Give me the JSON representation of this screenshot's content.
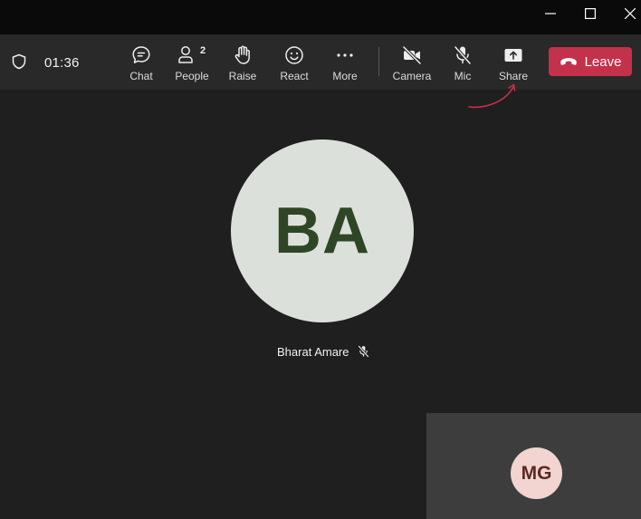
{
  "window": {
    "minimize_icon": "minimize-icon",
    "maximize_icon": "maximize-icon",
    "close_icon": "close-icon"
  },
  "toolbar": {
    "timer": "01:36",
    "shield_icon": "shield-icon",
    "buttons": [
      {
        "label": "Chat",
        "icon": "chat-icon"
      },
      {
        "label": "People",
        "icon": "people-icon",
        "count": "2"
      },
      {
        "label": "Raise",
        "icon": "hand-icon"
      },
      {
        "label": "React",
        "icon": "smiley-icon"
      },
      {
        "label": "More",
        "icon": "more-icon"
      },
      {
        "label": "Camera",
        "icon": "camera-off-icon"
      },
      {
        "label": "Mic",
        "icon": "mic-off-icon"
      },
      {
        "label": "Share",
        "icon": "share-icon"
      }
    ],
    "leave_label": "Leave"
  },
  "stage": {
    "main_participant": {
      "initials": "BA",
      "name": "Bharat Amare",
      "muted_icon": "mic-off-icon"
    },
    "self_view": {
      "initials": "MG"
    }
  },
  "colors": {
    "leave_button": "#c4314b",
    "annotation_arrow": "#c4314b",
    "main_avatar_bg": "#dbe1da",
    "main_avatar_text": "#2f4626",
    "self_avatar_bg": "#f2d4d0",
    "self_avatar_text": "#5b2a20"
  }
}
